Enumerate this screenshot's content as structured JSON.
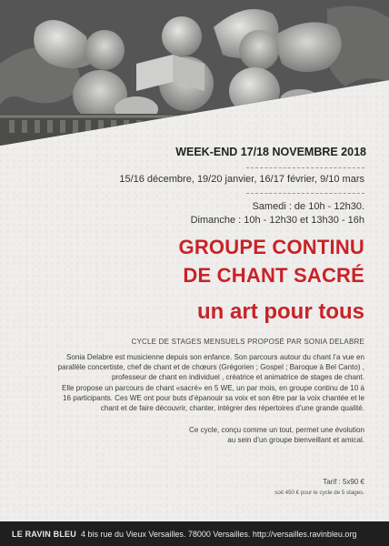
{
  "photo": {
    "icon": "cherub-sculpture-photo"
  },
  "event": {
    "weekend": "WEEK-END  17/18 NOVEMBRE 2018",
    "dates": "15/16 décembre, 19/20 janvier, 16/17 février, 9/10 mars",
    "saturday": "Samedi : de 10h - 12h30.",
    "sunday": "Dimanche : 10h - 12h30 et 13h30 - 16h"
  },
  "title": {
    "line1": "GROUPE CONTINU",
    "line2": "DE CHANT SACRÉ",
    "line3": "un art pour tous"
  },
  "subtitle": "CYCLE DE STAGES MENSUELS PROPOSÉ PAR SONIA DELABRE",
  "body": {
    "paragraph1": [
      "Sonia Delabre est musicienne depuis son enfance. Son parcours autour du chant l’a vue en",
      "parallèle concertiste, chef de chant et de chœurs (Grégorien ; Gospel ; Baroque à Bel Canto) ,",
      "professeur de chant en individuel , créatrice et animatrice de stages de chant.",
      "Elle propose un parcours de chant «sacré» en 5 WE, un par mois, en groupe continu de 10 à",
      "16 participants. Ces WE ont pour buts d’épanouir sa voix et son être par la voix chantée et le",
      "chant et de faire découvrir, chanter, intégrer des répertoires d’une grande qualité."
    ],
    "paragraph2": [
      "Ce cycle, conçu comme un tout, permet une évolution",
      "au sein d’un groupe bienveillant et amical."
    ]
  },
  "pricing": {
    "tarif": "Tarif : 5x90 €",
    "total": "soit 450 € pour le cycle de 5 stages."
  },
  "footer": {
    "brand": "LE RAVIN BLEU",
    "address": "4 bis rue du Vieux Versailles. 78000 Versailles. http://versailles.ravinbleu.org"
  },
  "colors": {
    "accent_red": "#c92227",
    "footer_bg": "#1f1f1f"
  }
}
